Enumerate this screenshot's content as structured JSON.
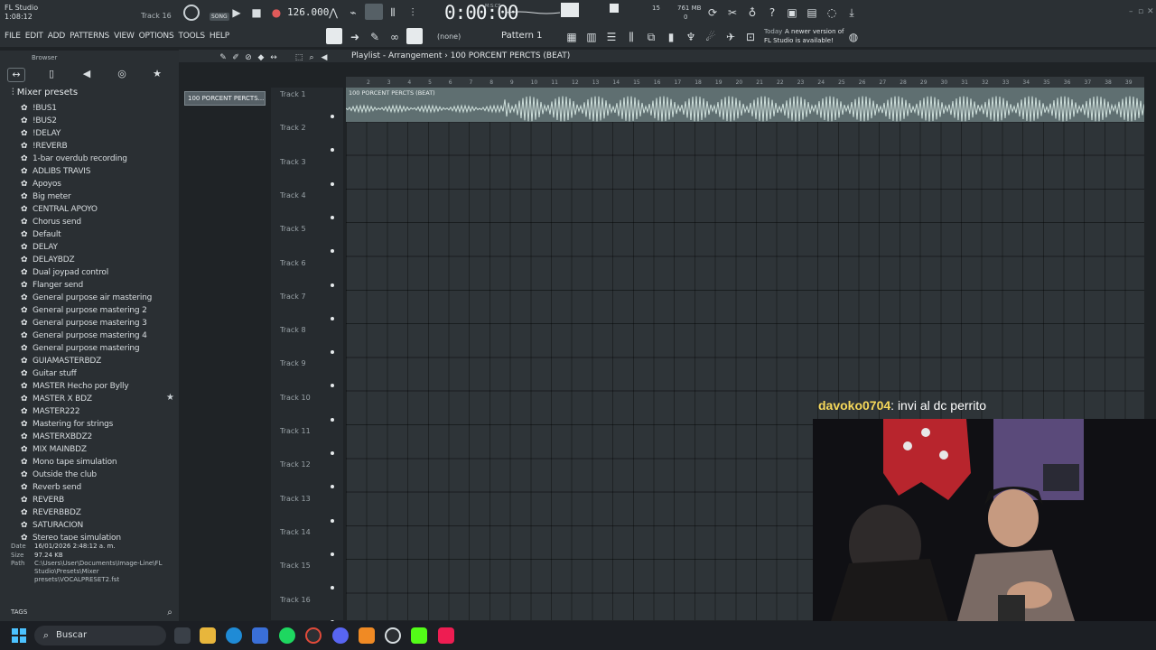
{
  "window": {
    "app_title": "FL Studio",
    "clock": "1:08:12",
    "hint": "Track 16",
    "song_mode": "SONG",
    "tempo": "126.000",
    "time": "0:00:00",
    "time_label": "M:S:CS",
    "cpu": "15",
    "memory": "761 MB",
    "memory_sub": "0"
  },
  "menu": [
    "FILE",
    "EDIT",
    "ADD",
    "PATTERNS",
    "VIEW",
    "OPTIONS",
    "TOOLS",
    "HELP"
  ],
  "toolbar": {
    "pattern_none": "(none)",
    "pattern_name": "Pattern 1",
    "news_today": "Today",
    "news_line1": "A newer version of",
    "news_line2": "FL Studio is available!"
  },
  "browser": {
    "title": "Browser",
    "folder": "Mixer presets",
    "presets": [
      "!BUS1",
      "!BUS2",
      "!DELAY",
      "!REVERB",
      "1-bar overdub recording",
      "ADLIBS TRAVIS",
      "Apoyos",
      "Big meter",
      "CENTRAL APOYO",
      "Chorus send",
      "Default",
      "DELAY",
      "DELAYBDZ",
      "Dual joypad control",
      "Flanger send",
      "General purpose air mastering",
      "General purpose mastering 2",
      "General purpose mastering 3",
      "General purpose mastering 4",
      "General purpose mastering",
      "GUIAMASTERBDZ",
      "Guitar stuff",
      "MASTER Hecho por Bylly",
      "MASTER X BDZ",
      "MASTER222",
      "Mastering for strings",
      "MASTERXBDZ2",
      "MIX MAINBDZ",
      "Mono tape simulation",
      "Outside the club",
      "Reverb send",
      "REVERB",
      "REVERBBDZ",
      "SATURACION",
      "Stereo tape simulation"
    ],
    "info": {
      "date_label": "Date",
      "date": "16/01/2026 2:48:12 a. m.",
      "size_label": "Size",
      "size": "97.24 KB",
      "path_label": "Path",
      "path": "C:\\Users\\User\\Documents\\Image-Line\\FL Studio\\Presets\\Mixer presets\\VOCALPRESET2.fst"
    },
    "tags": "TAGS"
  },
  "playlist": {
    "title": "Playlist - Arrangement",
    "pattern": "100 PORCENT PERCTS (BEAT)",
    "picker_pattern": "100 PORCENT PERCTS...",
    "clip_label": "100 PORCENT PERCTS (BEAT)",
    "tracks": [
      "Track 1",
      "Track 2",
      "Track 3",
      "Track 4",
      "Track 5",
      "Track 6",
      "Track 7",
      "Track 8",
      "Track 9",
      "Track 10",
      "Track 11",
      "Track 12",
      "Track 13",
      "Track 14",
      "Track 15",
      "Track 16"
    ],
    "bars": [
      "2",
      "3",
      "4",
      "5",
      "6",
      "7",
      "8",
      "9",
      "10",
      "11",
      "12",
      "13",
      "14",
      "15",
      "16",
      "17",
      "18",
      "19",
      "20",
      "21",
      "22",
      "23",
      "24",
      "25",
      "26",
      "27",
      "28",
      "29",
      "30",
      "31",
      "32",
      "33",
      "34",
      "35",
      "36",
      "37",
      "38",
      "39"
    ]
  },
  "overlay": {
    "chat_user": "davoko0704",
    "chat_message": ": invi al dc perrito"
  },
  "taskbar": {
    "search": "Buscar"
  }
}
